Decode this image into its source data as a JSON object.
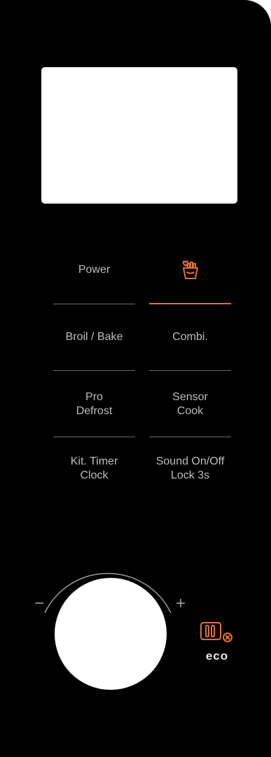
{
  "panel": {
    "buttons": {
      "power": "Power",
      "broil_bake": "Broil / Bake",
      "combi": "Combi.",
      "pro_defrost_line1": "Pro",
      "pro_defrost_line2": "Defrost",
      "sensor_cook_line1": "Sensor",
      "sensor_cook_line2": "Cook",
      "kit_timer_line1": "Kit. Timer",
      "kit_timer_line2": "Clock",
      "sound_line1": "Sound On/Off",
      "sound_line2": "Lock 3s"
    },
    "dial": {
      "minus": "−",
      "plus": "+"
    },
    "eco": {
      "label": "eco"
    }
  },
  "icons": {
    "fries": "fries-icon",
    "eco": "eco-icon"
  },
  "colors": {
    "panel_bg": "#000000",
    "label": "#bdbdbd",
    "accent": "#e0703a",
    "display": "#ffffff"
  }
}
